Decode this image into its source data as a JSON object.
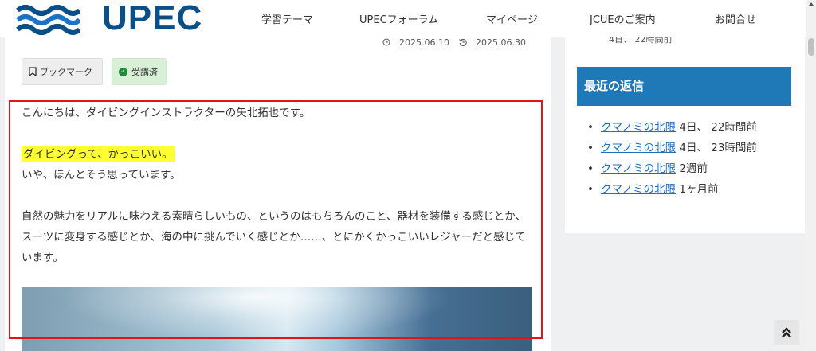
{
  "header": {
    "logo_text": "UPEC",
    "nav": [
      "学習テーマ",
      "UPECフォーラム",
      "マイページ",
      "JCUEのご案内",
      "お問合せ"
    ]
  },
  "article": {
    "published": "2025.06.10",
    "updated": "2025.06.30",
    "bookmark_label": "ブックマーク",
    "completed_label": "受講済",
    "paragraphs": {
      "p1": "こんにちは、ダイビングインストラクターの矢北拓也です。",
      "highlight": "ダイビングって、かっこいい。",
      "p2": "いや、ほんとそう思っています。",
      "p3": "自然の魅力をリアルに味わえる素晴らしいもの、というのはもちろんのこと、器材を装備する感じとか、スーツに変身する感じとか、海の中に挑んでいく感じとか……、とにかくかっこいいレジャーだと感じています。"
    }
  },
  "sidebar": {
    "top_partial": "4日、 22時間前",
    "recent_replies_title": "最近の返信",
    "replies": [
      {
        "link": "クマノミの北限",
        "time": "4日、 22時間前"
      },
      {
        "link": "クマノミの北限",
        "time": "4日、 23時間前"
      },
      {
        "link": "クマノミの北限",
        "time": "2週前"
      },
      {
        "link": "クマノミの北限",
        "time": "1ヶ月前"
      }
    ]
  },
  "colors": {
    "logo": "#0b4f87",
    "sidebar_heading": "#1f79b7",
    "highlight": "#ffff33",
    "annotation_box": "#e2141b",
    "link": "#1a6fc0"
  }
}
